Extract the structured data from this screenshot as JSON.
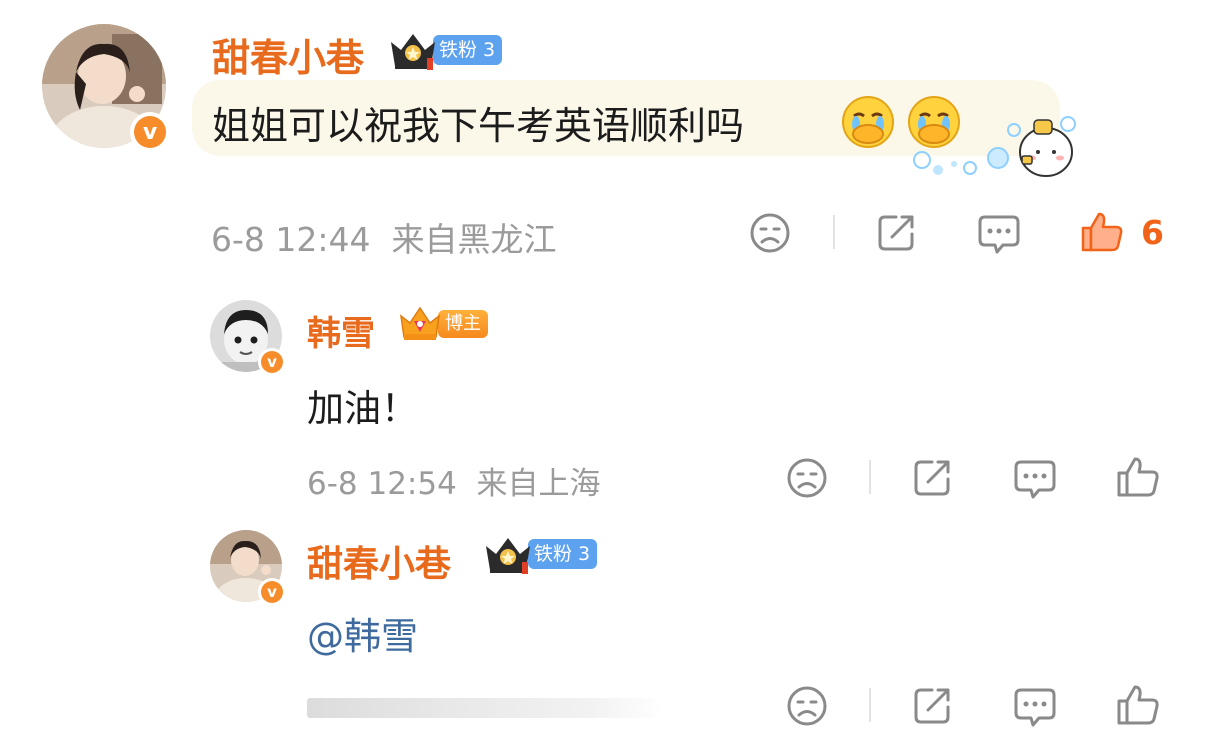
{
  "comment": {
    "username": "甜春小巷",
    "fan_badge": "铁粉 3",
    "text": "姐姐可以祝我下午考英语顺利吗",
    "emoji_names": [
      "crying-covering-mouth-emoji",
      "crying-covering-mouth-emoji"
    ],
    "sticker_name": "cartoon-bubbles-sticker",
    "time": "6-8 12:44",
    "location": "来自黑龙江",
    "like_count": "6",
    "liked_color": "#f2631a"
  },
  "replies": [
    {
      "username": "韩雪",
      "badge": "博主",
      "text": "加油！",
      "time": "6-8 12:54",
      "location": "来自上海"
    },
    {
      "username": "甜春小巷",
      "fan_badge": "铁粉 3",
      "text": "@韩雪",
      "time": "",
      "location": ""
    }
  ],
  "verified_badge": "v",
  "colors": {
    "username": "#e86a1c",
    "fan_badge_bg": "#5da2ef",
    "mention": "#3f6a9e",
    "meta": "#9b9b9b"
  }
}
